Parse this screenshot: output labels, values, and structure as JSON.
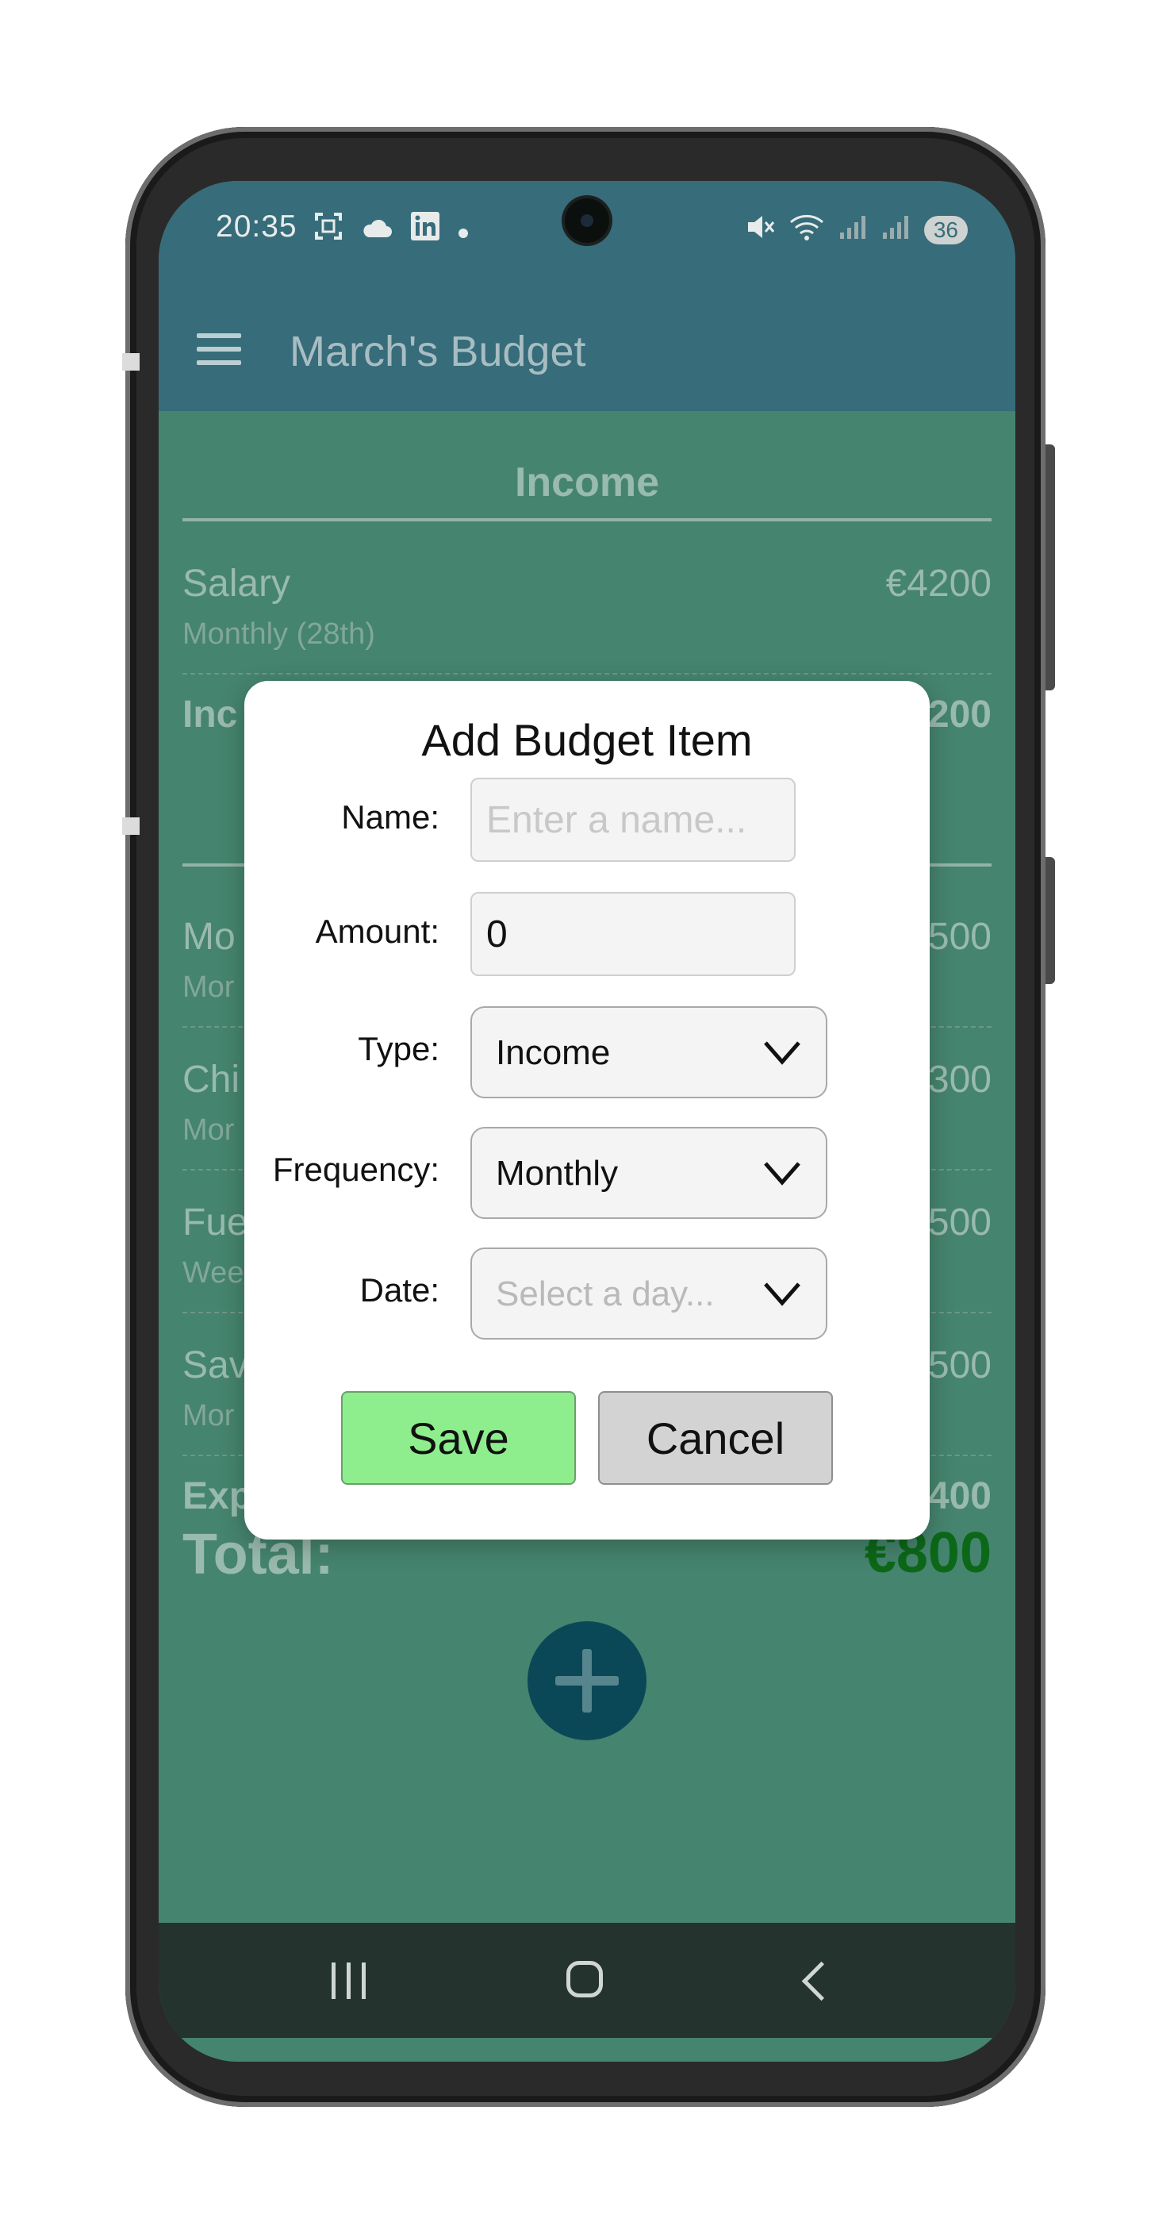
{
  "status_bar": {
    "time": "20:35",
    "left_icons": [
      "screenshot-icon",
      "cloud-icon",
      "linkedin-icon",
      "dot-icon"
    ],
    "right_icons": [
      "mute-icon",
      "wifi-icon",
      "signal-icon",
      "signal-icon"
    ],
    "battery": "36"
  },
  "app_bar": {
    "title": "March's Budget"
  },
  "income_section": {
    "title": "Income",
    "items": [
      {
        "name": "Salary",
        "frequency": "Monthly (28th)",
        "amount": "€4200"
      }
    ],
    "total_label": "Inc",
    "total_amount": "200"
  },
  "expense_section": {
    "items": [
      {
        "name": "Mo",
        "frequency": "Mor",
        "amount": "500"
      },
      {
        "name": "Chi",
        "frequency": "Mor",
        "amount": "300"
      },
      {
        "name": "Fue",
        "frequency": "Wee",
        "amount": "500"
      },
      {
        "name": "Sav",
        "frequency": "Mor",
        "amount": "500"
      }
    ],
    "total_label": "Exp",
    "total_amount": "400"
  },
  "total": {
    "label": "Total:",
    "value": "€800"
  },
  "dialog": {
    "title": "Add Budget Item",
    "name_label": "Name:",
    "name_placeholder": "Enter a name...",
    "amount_label": "Amount:",
    "amount_value": "0",
    "type_label": "Type:",
    "type_value": "Income",
    "frequency_label": "Frequency:",
    "frequency_value": "Monthly",
    "date_label": "Date:",
    "date_placeholder": "Select a day...",
    "save_label": "Save",
    "cancel_label": "Cancel"
  },
  "colors": {
    "app_bar": "#3c7283",
    "background": "#4b8d75",
    "total_value": "#0c6e16",
    "save_button": "#8eee8e",
    "cancel_button": "#d3d3d3",
    "fab": "#0b4a5c"
  }
}
